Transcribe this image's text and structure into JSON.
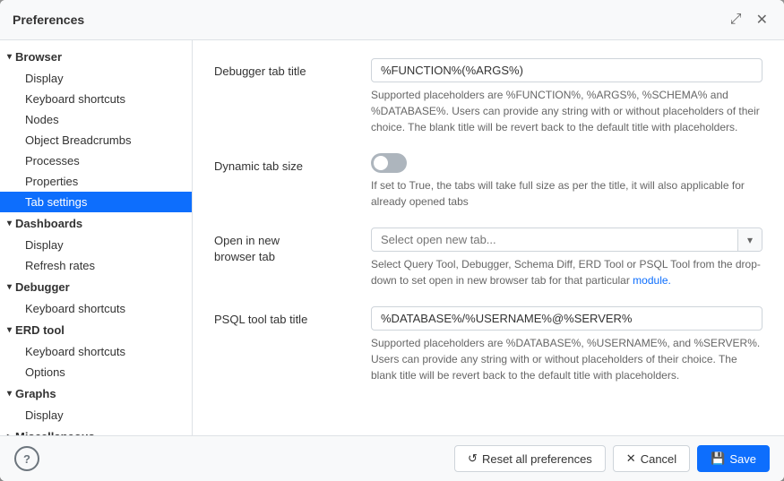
{
  "dialog": {
    "title": "Preferences",
    "expand_icon": "⤢",
    "close_icon": "✕"
  },
  "sidebar": {
    "groups": [
      {
        "label": "Browser",
        "expanded": true,
        "children": [
          {
            "label": "Display",
            "active": false
          },
          {
            "label": "Keyboard shortcuts",
            "active": false
          },
          {
            "label": "Nodes",
            "active": false
          },
          {
            "label": "Object Breadcrumbs",
            "active": false
          },
          {
            "label": "Processes",
            "active": false
          },
          {
            "label": "Properties",
            "active": false
          },
          {
            "label": "Tab settings",
            "active": true
          }
        ]
      },
      {
        "label": "Dashboards",
        "expanded": true,
        "children": [
          {
            "label": "Display",
            "active": false
          },
          {
            "label": "Refresh rates",
            "active": false
          }
        ]
      },
      {
        "label": "Debugger",
        "expanded": true,
        "children": [
          {
            "label": "Keyboard shortcuts",
            "active": false
          }
        ]
      },
      {
        "label": "ERD tool",
        "expanded": true,
        "children": [
          {
            "label": "Keyboard shortcuts",
            "active": false
          },
          {
            "label": "Options",
            "active": false
          }
        ]
      },
      {
        "label": "Graphs",
        "expanded": true,
        "children": [
          {
            "label": "Display",
            "active": false
          }
        ]
      },
      {
        "label": "Miscellaneous",
        "expanded": false,
        "children": []
      }
    ]
  },
  "form": {
    "fields": [
      {
        "id": "debugger_tab_title",
        "label": "Debugger tab title",
        "type": "input",
        "value": "%FUNCTION%(%ARGS%)",
        "help": "Supported placeholders are %FUNCTION%, %ARGS%, %SCHEMA% and %DATABASE%. Users can provide any string with or without placeholders of their choice. The blank title will be revert back to the default title with placeholders."
      },
      {
        "id": "dynamic_tab_size",
        "label": "Dynamic tab size",
        "type": "toggle",
        "value": false,
        "help": "If set to True, the tabs will take full size as per the title, it will also applicable for already opened tabs"
      },
      {
        "id": "open_in_new_browser_tab",
        "label": "Open in new browser tab",
        "type": "select",
        "placeholder": "Select open new tab...",
        "help": "Select Query Tool, Debugger, Schema Diff, ERD Tool or PSQL Tool from the drop-down to set open in new browser tab for that particular module.",
        "help_link": "module."
      },
      {
        "id": "psql_tool_tab_title",
        "label": "PSQL tool tab title",
        "type": "input",
        "value": "%DATABASE%/%USERNAME%@%SERVER%",
        "help": "Supported placeholders are %DATABASE%, %USERNAME%, and %SERVER%. Users can provide any string with or without placeholders of their choice. The blank title will be revert back to the default title with placeholders."
      }
    ]
  },
  "footer": {
    "help_label": "?",
    "reset_label": "Reset all preferences",
    "cancel_label": "Cancel",
    "save_label": "Save",
    "reset_icon": "↺",
    "cancel_icon": "✕",
    "save_icon": "💾"
  }
}
